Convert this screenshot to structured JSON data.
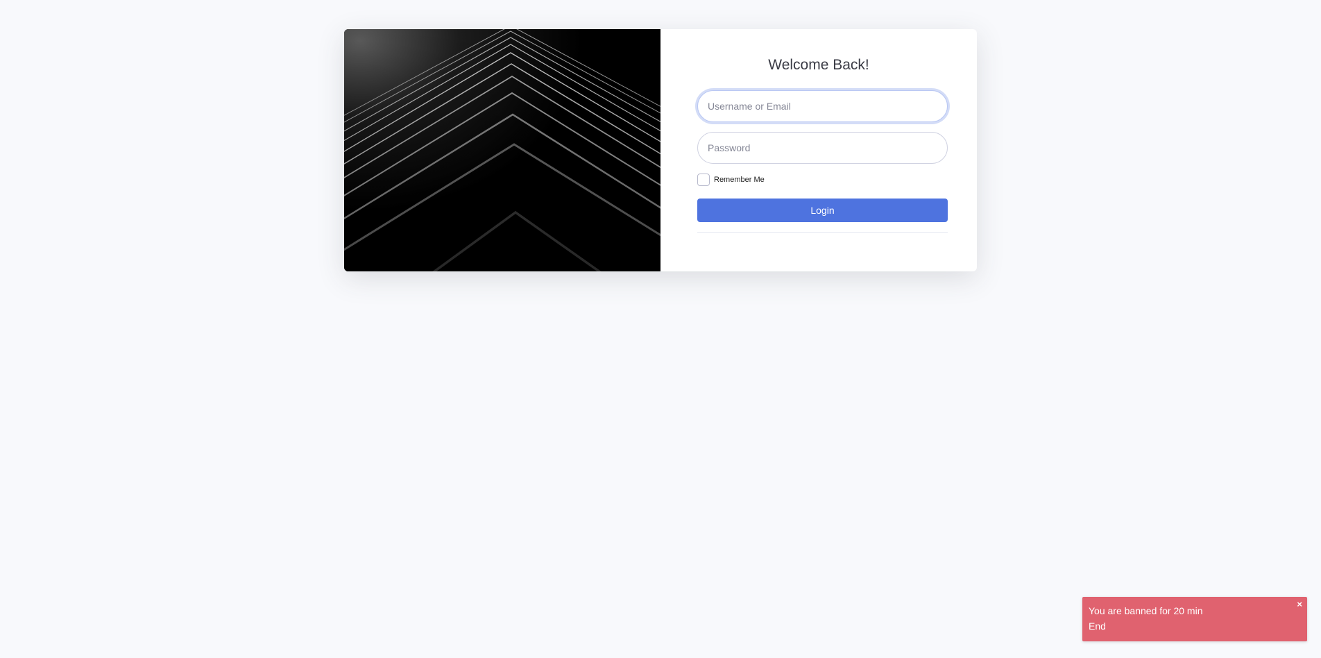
{
  "login": {
    "title": "Welcome Back!",
    "username_placeholder": "Username or Email",
    "username_value": "",
    "password_placeholder": "Password",
    "password_value": "",
    "remember_label": "Remember Me",
    "remember_checked": false,
    "login_label": "Login"
  },
  "toast": {
    "message": "You are banned for 20 min",
    "sub": "End",
    "close_label": "×"
  },
  "colors": {
    "primary": "#4e73df",
    "toast_bg": "#e0626f",
    "page_bg": "#f8f9fc"
  }
}
